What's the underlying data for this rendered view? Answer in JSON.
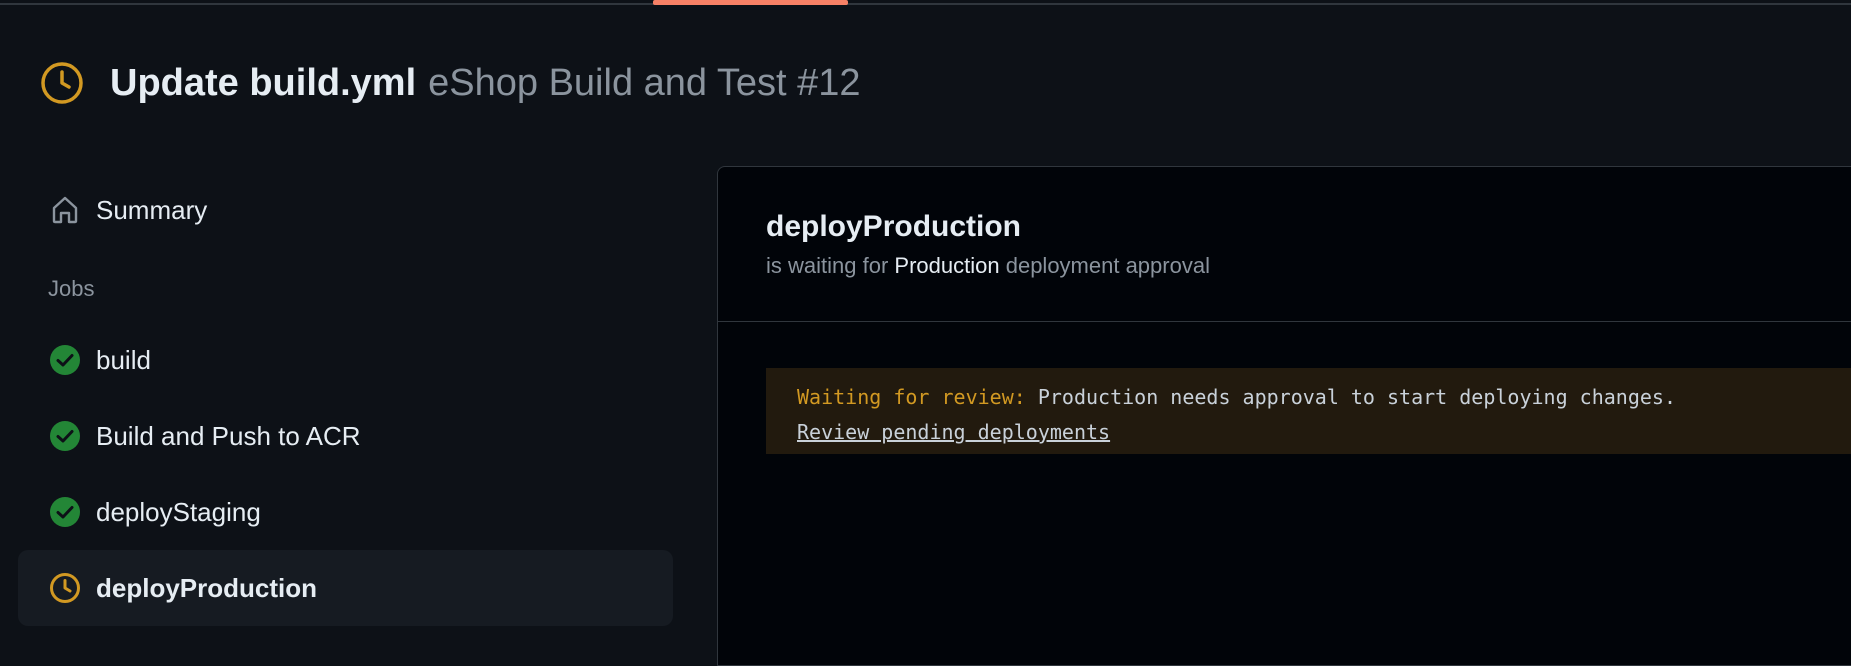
{
  "header": {
    "title": "Update build.yml",
    "subtitle": "eShop Build and Test #12",
    "status_icon": "clock-icon",
    "status_color": "#d29922"
  },
  "sidebar": {
    "summary_label": "Summary",
    "jobs_heading": "Jobs",
    "jobs": [
      {
        "label": "build",
        "status": "success",
        "icon": "check-circle-icon"
      },
      {
        "label": "Build and Push to ACR",
        "status": "success",
        "icon": "check-circle-icon"
      },
      {
        "label": "deployStaging",
        "status": "success",
        "icon": "check-circle-icon"
      },
      {
        "label": "deployProduction",
        "status": "waiting",
        "icon": "clock-icon",
        "selected": true
      }
    ]
  },
  "panel": {
    "job_title": "deployProduction",
    "sub_prefix": "is waiting for",
    "environment": "Production",
    "sub_suffix": "deployment approval",
    "notice": {
      "label": "Waiting for review:",
      "message": "Production needs approval to start deploying changes.",
      "link": "Review pending deployments"
    }
  },
  "colors": {
    "success": "#238636",
    "waiting": "#d29922",
    "accent_tab": "#f78166"
  }
}
